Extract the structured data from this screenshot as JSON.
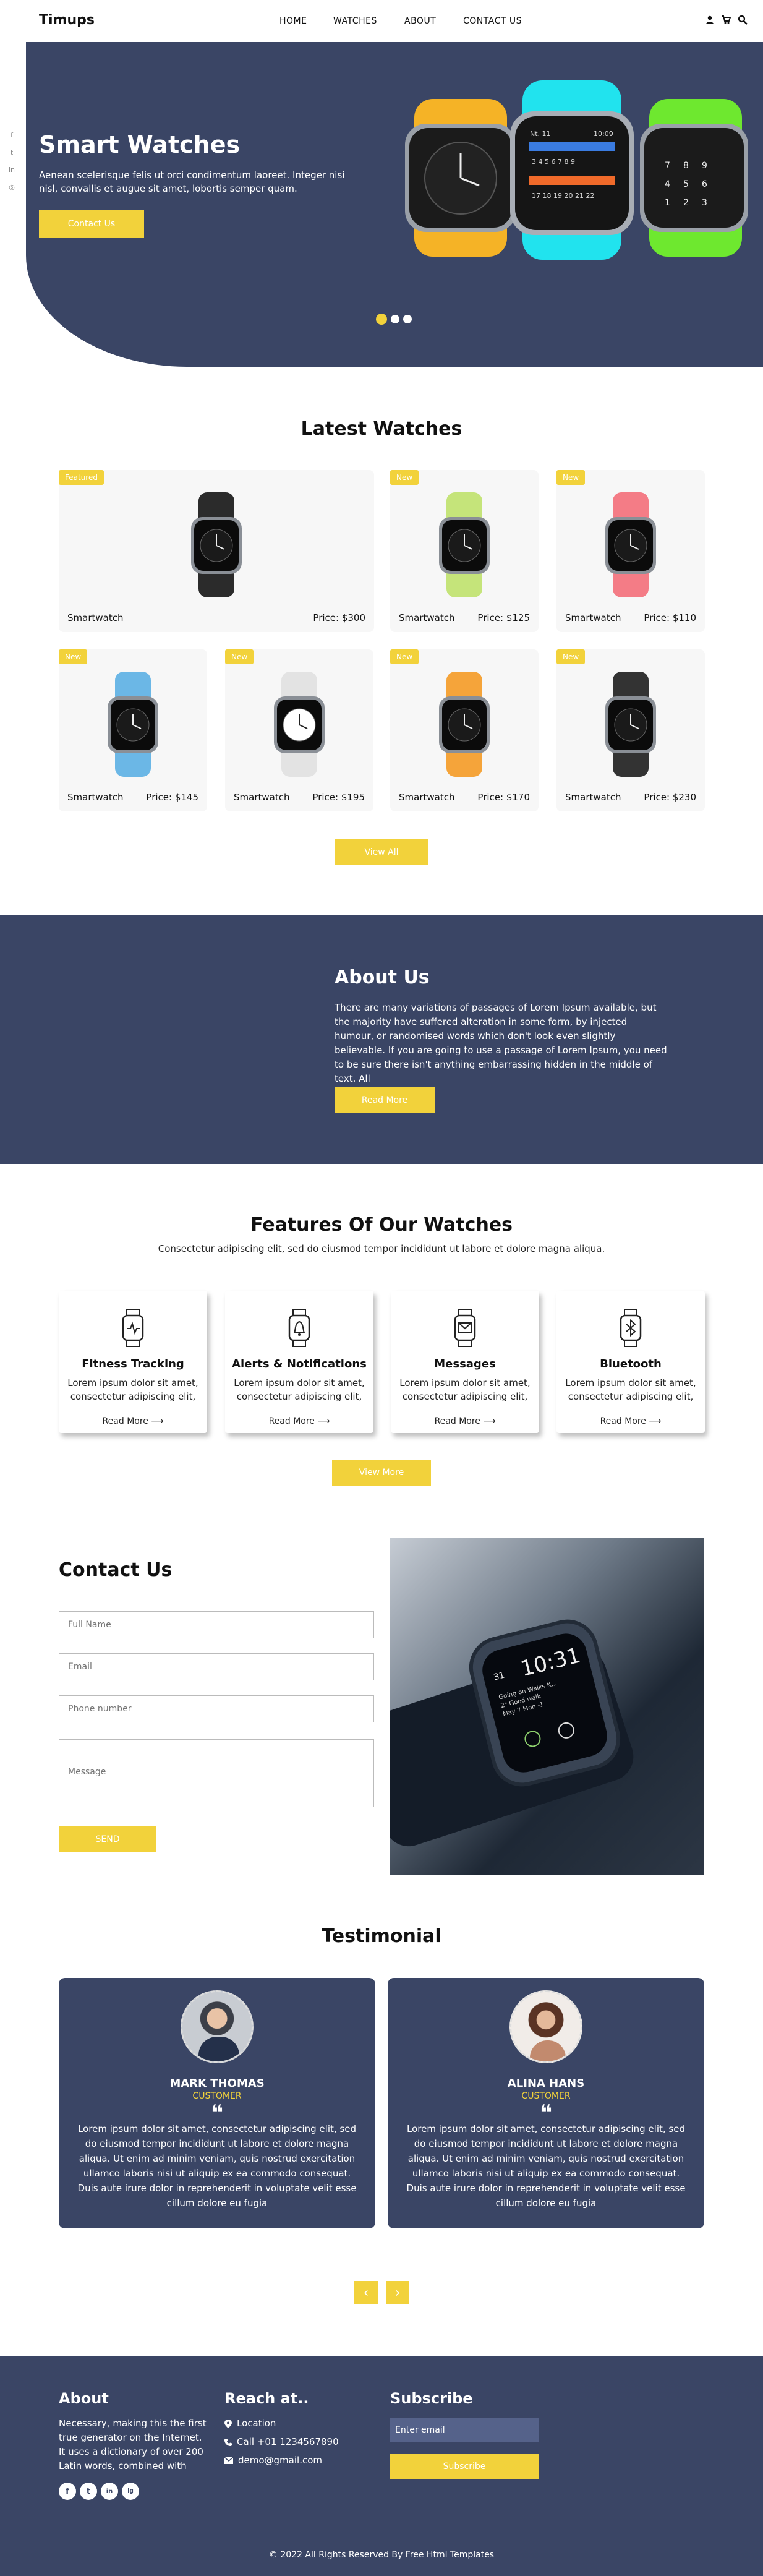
{
  "header": {
    "logo": "Timups",
    "nav": [
      "HOME",
      "WATCHES",
      "ABOUT",
      "CONTACT US"
    ]
  },
  "hero": {
    "title": "Smart Watches",
    "text": "Aenean scelerisque felis ut orci condimentum laoreet. Integer nisi nisl, convallis et augue sit amet, lobortis semper quam.",
    "button": "Contact Us",
    "slide_count": 3,
    "active_slide": 1
  },
  "latest": {
    "title": "Latest Watches",
    "products": [
      {
        "badge": "Featured",
        "name": "Smartwatch",
        "price": "Price: $300",
        "band": "#2b2b2b"
      },
      {
        "badge": "New",
        "name": "Smartwatch",
        "price": "Price: $125",
        "band": "#c5e47a"
      },
      {
        "badge": "New",
        "name": "Smartwatch",
        "price": "Price: $110",
        "band": "#f47c86"
      },
      {
        "badge": "New",
        "name": "Smartwatch",
        "price": "Price: $145",
        "band": "#6bb7e6"
      },
      {
        "badge": "New",
        "name": "Smartwatch",
        "price": "Price: $195",
        "band": "#e3e3e3"
      },
      {
        "badge": "New",
        "name": "Smartwatch",
        "price": "Price: $170",
        "band": "#f5a43a"
      },
      {
        "badge": "New",
        "name": "Smartwatch",
        "price": "Price: $230",
        "band": "#333333"
      }
    ],
    "view_all": "View All"
  },
  "about": {
    "title": "About Us",
    "text": "There are many variations of passages of Lorem Ipsum available, but the majority have suffered alteration in some form, by injected humour, or randomised words which don't look even slightly believable. If you are going to use a passage of Lorem Ipsum, you need to be sure there isn't anything embarrassing hidden in the middle of text. All",
    "button": "Read More"
  },
  "features": {
    "title": "Features Of Our Watches",
    "subtitle": "Consectetur adipiscing elit, sed do eiusmod tempor incididunt ut labore et dolore magna aliqua.",
    "items": [
      {
        "title": "Fitness Tracking",
        "text": "Lorem ipsum dolor sit amet, consectetur adipiscing elit,",
        "more": "Read More ⟶",
        "icon": "watch-icon"
      },
      {
        "title": "Alerts & Notifications",
        "text": "Lorem ipsum dolor sit amet, consectetur adipiscing elit,",
        "more": "Read More ⟶",
        "icon": "bell-icon"
      },
      {
        "title": "Messages",
        "text": "Lorem ipsum dolor sit amet, consectetur adipiscing elit,",
        "more": "Read More ⟶",
        "icon": "mail-icon"
      },
      {
        "title": "Bluetooth",
        "text": "Lorem ipsum dolor sit amet, consectetur adipiscing elit,",
        "more": "Read More ⟶",
        "icon": "bluetooth-icon"
      }
    ],
    "view_more": "View More"
  },
  "contact": {
    "title": "Contact Us",
    "fields": {
      "name": "Full Name",
      "email": "Email",
      "phone": "Phone number",
      "message": "Message"
    },
    "send": "SEND",
    "watch_time": "10:31",
    "watch_date": "31",
    "watch_line1": "Going on Walks K...",
    "watch_line2": "2\" Good walk",
    "watch_line3": "May 7 Mon -1"
  },
  "testimonial": {
    "title": "Testimonial",
    "items": [
      {
        "name": "MARK THOMAS",
        "role": "CUSTOMER",
        "quote": "❝",
        "text": "Lorem ipsum dolor sit amet, consectetur adipiscing elit, sed do eiusmod tempor incididunt ut labore et dolore magna aliqua. Ut enim ad minim veniam, quis nostrud exercitation ullamco laboris nisi ut aliquip ex ea commodo consequat. Duis aute irure dolor in reprehenderit in voluptate velit esse cillum dolore eu fugia"
      },
      {
        "name": "ALINA HANS",
        "role": "CUSTOMER",
        "quote": "❝",
        "text": "Lorem ipsum dolor sit amet, consectetur adipiscing elit, sed do eiusmod tempor incididunt ut labore et dolore magna aliqua. Ut enim ad minim veniam, quis nostrud exercitation ullamco laboris nisi ut aliquip ex ea commodo consequat. Duis aute irure dolor in reprehenderit in voluptate velit esse cillum dolore eu fugia"
      }
    ],
    "prev": "‹",
    "next": "›"
  },
  "footer": {
    "about_title": "About",
    "about_text": "Necessary, making this the first true generator on the Internet. It uses a dictionary of over 200 Latin words, combined with",
    "reach_title": "Reach at..",
    "location": "Location",
    "phone": "Call +01 1234567890",
    "email": "demo@gmail.com",
    "subscribe_title": "Subscribe",
    "subscribe_placeholder": "Enter email",
    "subscribe_button": "Subscribe",
    "copyright": "© 2022 All Rights Reserved By Free Html Templates",
    "social": [
      "f",
      "t",
      "in",
      "ig"
    ]
  },
  "colors": {
    "navy": "#3a4565",
    "accent": "#f2d23b"
  }
}
